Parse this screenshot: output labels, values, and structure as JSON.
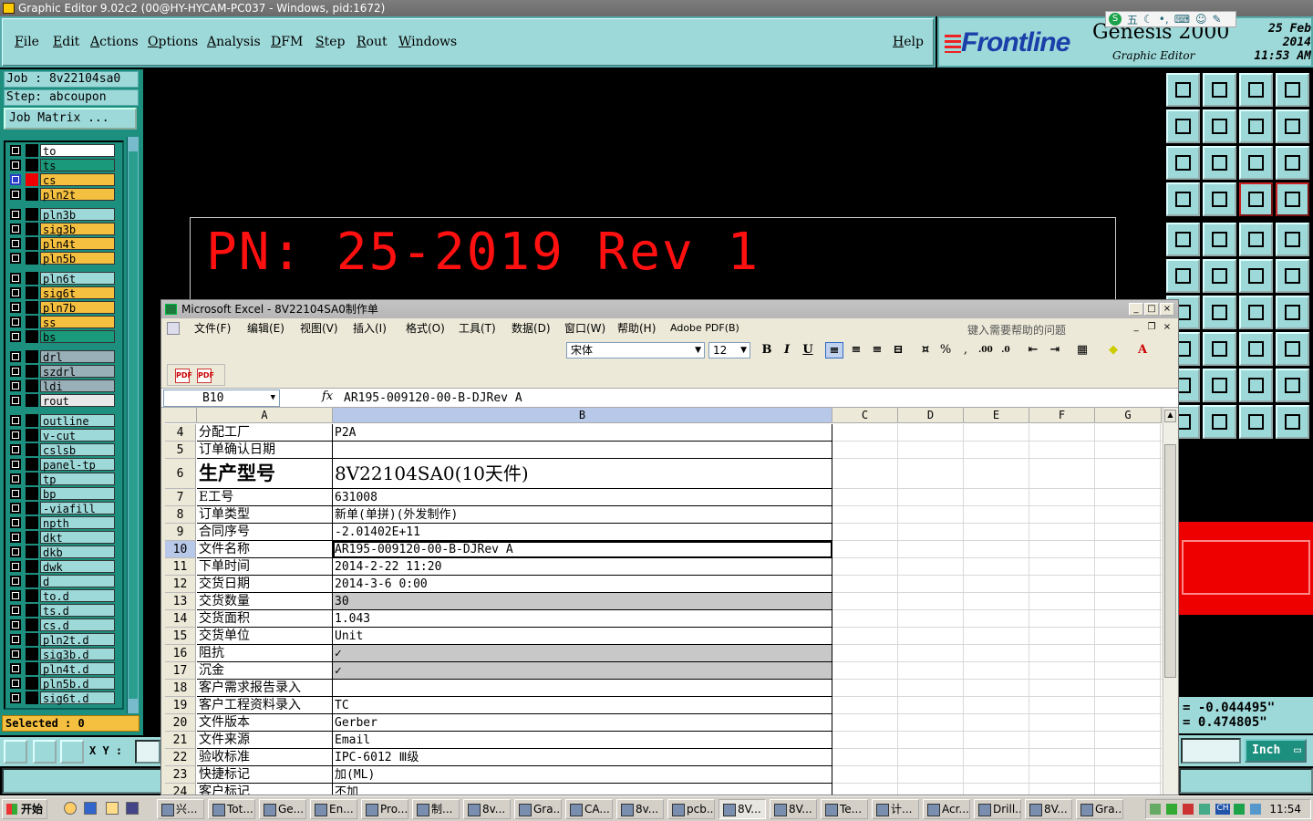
{
  "genesis": {
    "window_title": "Graphic Editor 9.02c2 (00@HY-HYCAM-PC037 - Windows, pid:1672)",
    "menu": [
      "File",
      "Edit",
      "Actions",
      "Options",
      "Analysis",
      "DFM",
      "Step",
      "Rout",
      "Windows"
    ],
    "help": "Help",
    "logo": {
      "brand": "Frontline",
      "product": "Genesis 2000",
      "subtitle": "Graphic Editor"
    },
    "date": "25 Feb 2014",
    "time": "11:53 AM",
    "ime": "五"
  },
  "left_panel": {
    "job": "Job : 8v22104sa0",
    "step": "Step: abcoupon",
    "job_matrix": "Job Matrix ...",
    "layers": [
      {
        "name": "to",
        "color": "#ffffff"
      },
      {
        "name": "ts",
        "color": "#1a9a7a"
      },
      {
        "name": "cs",
        "color": "#f5c040",
        "active": true
      },
      {
        "name": "pln2t",
        "color": "#f5c040"
      },
      {
        "name": "pln3b",
        "color": "#9ed9d9"
      },
      {
        "name": "sig3b",
        "color": "#f5c040"
      },
      {
        "name": "pln4t",
        "color": "#f5c040"
      },
      {
        "name": "pln5b",
        "color": "#f5c040"
      },
      {
        "name": "pln6t",
        "color": "#9ed9d9"
      },
      {
        "name": "sig6t",
        "color": "#f5c040"
      },
      {
        "name": "pln7b",
        "color": "#f5c040"
      },
      {
        "name": "ss",
        "color": "#f5c040"
      },
      {
        "name": "bs",
        "color": "#1a9a7a"
      },
      {
        "name": "drl",
        "color": "#9ab0b8"
      },
      {
        "name": "szdrl",
        "color": "#9ab0b8"
      },
      {
        "name": "ldi",
        "color": "#9ab0b8"
      },
      {
        "name": "rout",
        "color": "#e8e8e8"
      },
      {
        "name": "outline",
        "color": "#9ed9d9"
      },
      {
        "name": "v-cut",
        "color": "#9ed9d9"
      },
      {
        "name": "cslsb",
        "color": "#9ed9d9"
      },
      {
        "name": "panel-tp",
        "color": "#9ed9d9"
      },
      {
        "name": "tp",
        "color": "#9ed9d9"
      },
      {
        "name": "bp",
        "color": "#9ed9d9"
      },
      {
        "name": "-viafill",
        "color": "#9ed9d9"
      },
      {
        "name": "npth",
        "color": "#9ed9d9"
      },
      {
        "name": "dkt",
        "color": "#9ed9d9"
      },
      {
        "name": "dkb",
        "color": "#9ed9d9"
      },
      {
        "name": "dwk",
        "color": "#9ed9d9"
      },
      {
        "name": "d",
        "color": "#9ed9d9"
      },
      {
        "name": "to.d",
        "color": "#9ed9d9"
      },
      {
        "name": "ts.d",
        "color": "#9ed9d9"
      },
      {
        "name": "cs.d",
        "color": "#9ed9d9"
      },
      {
        "name": "pln2t.d",
        "color": "#9ed9d9"
      },
      {
        "name": "sig3b.d",
        "color": "#9ed9d9"
      },
      {
        "name": "pln4t.d",
        "color": "#9ed9d9"
      },
      {
        "name": "pln5b.d",
        "color": "#9ed9d9"
      },
      {
        "name": "sig6t.d",
        "color": "#9ed9d9"
      }
    ],
    "selected": "Selected : 0",
    "xy_label": "X Y :"
  },
  "canvas": {
    "pn_text": "PN: 25-2019 Rev 1"
  },
  "right_panel": {
    "coord_x": "= -0.044495\"",
    "coord_y": "= 0.474805\"",
    "unit": "Inch"
  },
  "excel": {
    "title": "Microsoft Excel - 8V22104SA0制作单",
    "menu": [
      "文件(F)",
      "编辑(E)",
      "视图(V)",
      "插入(I)",
      "格式(O)",
      "工具(T)",
      "数据(D)",
      "窗口(W)",
      "帮助(H)",
      "Adobe PDF(B)"
    ],
    "help_placeholder": "键入需要帮助的问题",
    "font": "宋体",
    "font_size": "12",
    "name_box": "B10",
    "formula": "AR195-009120-00-B-DJRev A",
    "columns": [
      "A",
      "B",
      "C",
      "D",
      "E",
      "F",
      "G"
    ],
    "rows": [
      {
        "num": "4",
        "a": "分配工厂",
        "b": "P2A"
      },
      {
        "num": "5",
        "a": "订单确认日期",
        "b": ""
      },
      {
        "num": "6",
        "a": "生产型号",
        "b": "8V22104SA0(10天件)"
      },
      {
        "num": "7",
        "a": "E工号",
        "b": "631008"
      },
      {
        "num": "8",
        "a": "订单类型",
        "b": "新单(单拼)(外发制作)"
      },
      {
        "num": "9",
        "a": "合同序号",
        "b": "-2.01402E+11"
      },
      {
        "num": "10",
        "a": "文件名称",
        "b": "AR195-009120-00-B-DJRev A"
      },
      {
        "num": "11",
        "a": "下单时间",
        "b": "2014-2-22 11:20"
      },
      {
        "num": "12",
        "a": "交货日期",
        "b": "2014-3-6 0:00"
      },
      {
        "num": "13",
        "a": "交货数量",
        "b": "30"
      },
      {
        "num": "14",
        "a": "交货面积",
        "b": "1.043"
      },
      {
        "num": "15",
        "a": "交货单位",
        "b": "Unit"
      },
      {
        "num": "16",
        "a": "阻抗",
        "b": "✓"
      },
      {
        "num": "17",
        "a": "沉金",
        "b": "✓"
      },
      {
        "num": "18",
        "a": "客户需求报告录入",
        "b": ""
      },
      {
        "num": "19",
        "a": "客户工程资料录入",
        "b": "TC"
      },
      {
        "num": "20",
        "a": "文件版本",
        "b": "Gerber"
      },
      {
        "num": "21",
        "a": "文件来源",
        "b": "Email"
      },
      {
        "num": "22",
        "a": "验收标准",
        "b": "IPC-6012 Ⅲ级"
      },
      {
        "num": "23",
        "a": "快捷标记",
        "b": "加(ML)"
      },
      {
        "num": "24",
        "a": "客户标记",
        "b": "不加"
      }
    ]
  },
  "taskbar": {
    "start": "开始",
    "tasks": [
      "兴...",
      "Tot...",
      "Ge...",
      "En...",
      "Pro...",
      "制...",
      "8v...",
      "Gra...",
      "CA...",
      "8v...",
      "pcb...",
      "8V...",
      "8V...",
      "Te...",
      "计...",
      "Acr...",
      "Drill...",
      "8V...",
      "Gra..."
    ],
    "tray_lang": "CH",
    "clock": "11:54"
  }
}
